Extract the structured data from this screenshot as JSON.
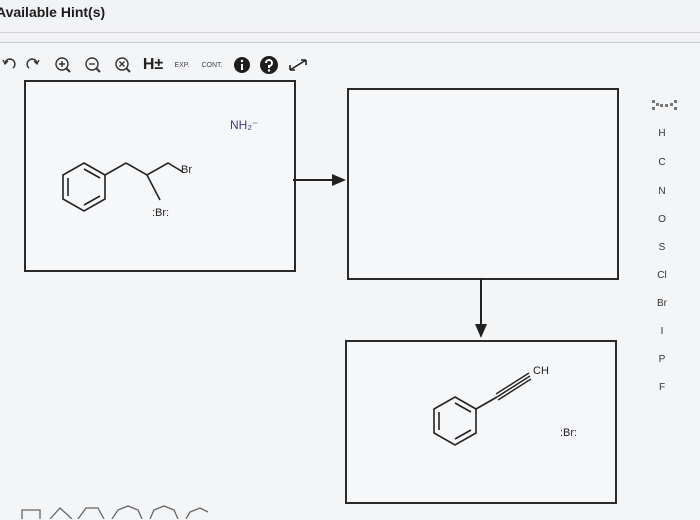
{
  "header": {
    "title": "Available Hint(s)"
  },
  "toolbar": {
    "hplus_label": "H±",
    "exp_label": "EXP.",
    "cont_label": "CONT."
  },
  "reactant": {
    "br1": "Br",
    "br2": ":Br:"
  },
  "reagent": {
    "label": "NH₂⁻"
  },
  "product": {
    "ch_label": "CH",
    "br_label": ":Br:"
  },
  "sidebar": {
    "elements": [
      "H",
      "C",
      "N",
      "O",
      "S",
      "Cl",
      "Br",
      "I",
      "P",
      "F"
    ]
  }
}
